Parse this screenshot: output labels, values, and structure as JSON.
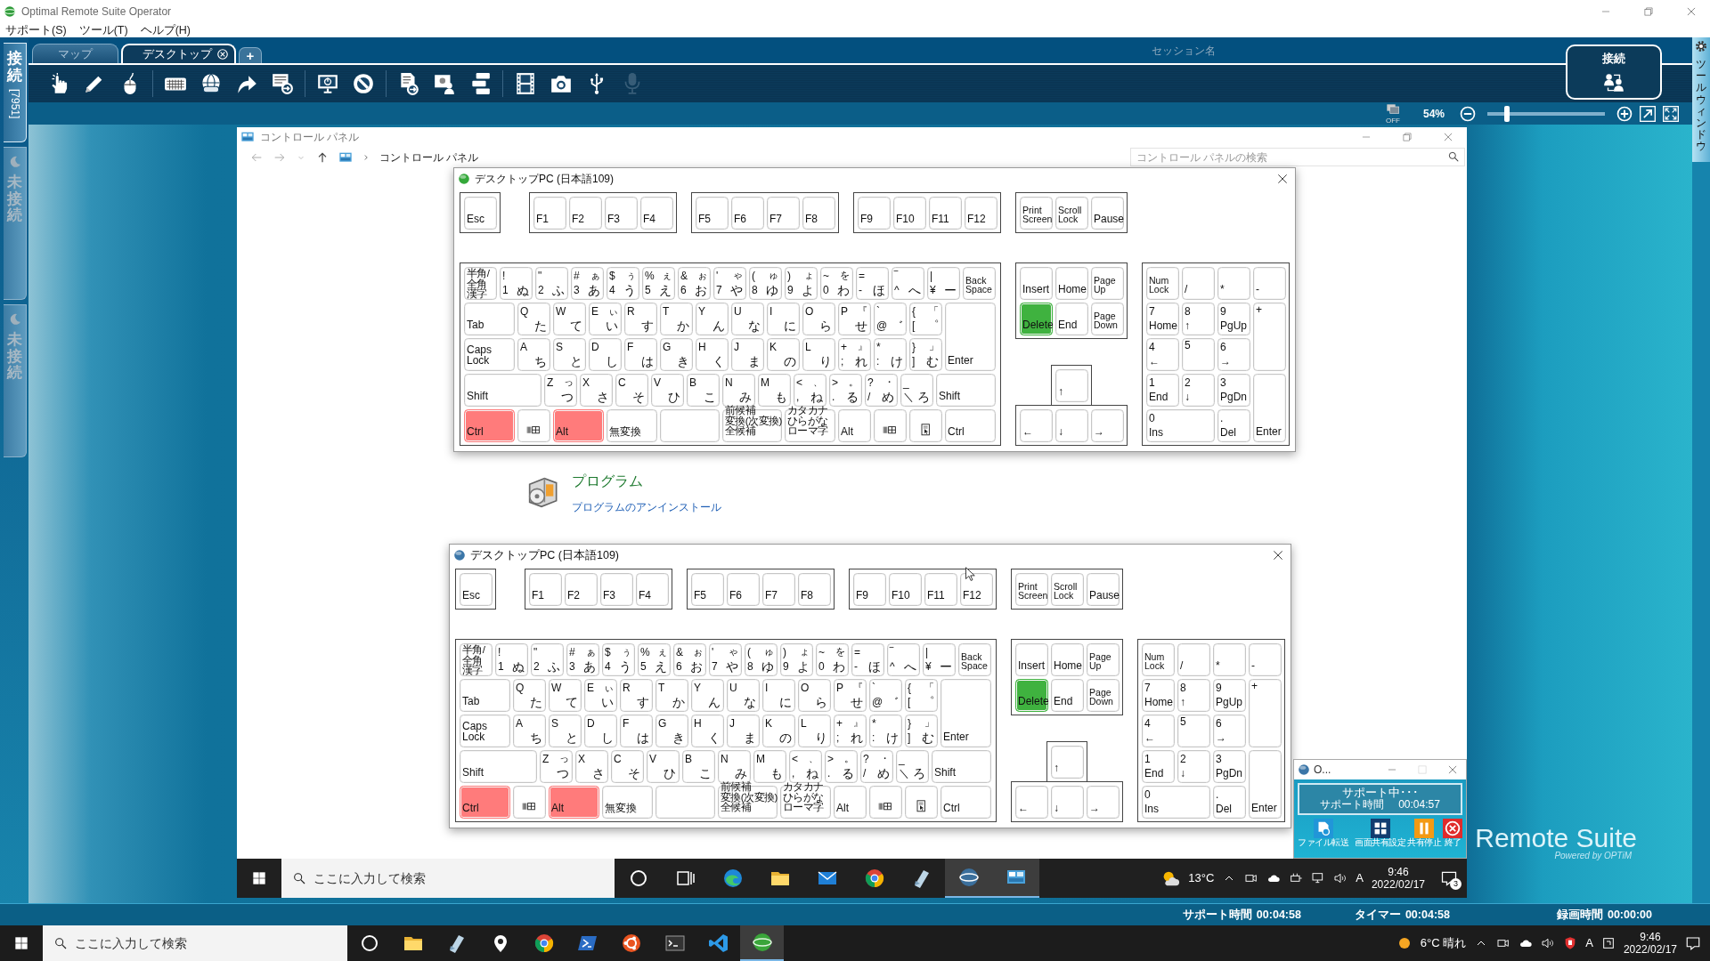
{
  "app": {
    "title": "Optimal Remote Suite Operator"
  },
  "menu": [
    "サポート(S)",
    "ツール(T)",
    "ヘルプ(H)"
  ],
  "side_tabs": [
    {
      "label": "接続",
      "detail": "[7951]",
      "selected": true
    },
    {
      "label": "未接続",
      "selected": false
    },
    {
      "label": "未接続",
      "selected": false
    }
  ],
  "tabs": [
    {
      "label": "マップ",
      "selected": false,
      "closable": false
    },
    {
      "label": "デスクトップ",
      "selected": true,
      "closable": true
    }
  ],
  "add_tab": "+",
  "toolbar": [
    [
      {
        "kind": "hand",
        "disabled": false
      },
      {
        "kind": "pencil",
        "disabled": false
      },
      {
        "kind": "mouse",
        "disabled": false
      }
    ],
    [
      {
        "kind": "keyboard",
        "disabled": false
      },
      {
        "kind": "globe",
        "disabled": false
      },
      {
        "kind": "arrow",
        "disabled": false
      },
      {
        "kind": "screendoc",
        "disabled": false
      }
    ],
    [
      {
        "kind": "monitor",
        "disabled": false
      },
      {
        "kind": "prohibit",
        "disabled": false
      }
    ],
    [
      {
        "kind": "docsend",
        "disabled": false
      },
      {
        "kind": "people",
        "disabled": false
      },
      {
        "kind": "keys",
        "disabled": false
      }
    ],
    [
      {
        "kind": "film",
        "disabled": false
      },
      {
        "kind": "camera",
        "disabled": false
      },
      {
        "kind": "usb",
        "disabled": false
      },
      {
        "kind": "mic",
        "disabled": true
      }
    ]
  ],
  "session_label": "セッション名",
  "connect_panel": {
    "label": "接続"
  },
  "zoom": {
    "monitor_label": "OFF",
    "percent": "54%",
    "level": 0.17
  },
  "tool_window_tab": "ツールウィンドウ",
  "remote": {
    "control_panel": {
      "title": "コントロール パネル",
      "breadcrumb": "コントロール パネル",
      "search_placeholder": "コントロール パネルの検索",
      "category": {
        "title": "プログラム",
        "link": "プログラムのアンインストール"
      }
    },
    "keyboards": [
      {
        "title": "デスクトップPC (日本語109)",
        "active": true,
        "fn": [
          [
            {
              "bl": "Esc",
              "pressed": false
            }
          ],
          [
            {
              "bl": "F1",
              "pressed": false
            },
            {
              "bl": "F2",
              "pressed": false
            },
            {
              "bl": "F3",
              "pressed": false
            },
            {
              "bl": "F4",
              "pressed": false
            }
          ],
          [
            {
              "bl": "F5",
              "pressed": false
            },
            {
              "bl": "F6",
              "pressed": false
            },
            {
              "bl": "F7",
              "pressed": false
            },
            {
              "bl": "F8",
              "pressed": false
            }
          ],
          [
            {
              "bl": "F9",
              "pressed": false
            },
            {
              "bl": "F10",
              "pressed": false
            },
            {
              "bl": "F11",
              "pressed": false
            },
            {
              "bl": "F12",
              "pressed": false
            }
          ],
          [
            {
              "bl": [
                "Print",
                "Screen"
              ],
              "pressed": false
            },
            {
              "bl": [
                "Scroll",
                "Lock"
              ],
              "pressed": false
            },
            {
              "bl": "Pause",
              "pressed": false
            }
          ]
        ],
        "main": [
          [
            {
              "tl": [
                "半角/",
                "全角",
                "漢字"
              ],
              "pressed": false
            },
            {
              "tl": "!",
              "bl": "1",
              "br": "ぬ",
              "pressed": false
            },
            {
              "tl": "\"",
              "bl": "2",
              "br": "ふ",
              "pressed": false
            },
            {
              "tl": "#",
              "tr": "ぁ",
              "bl": "3",
              "br": "あ",
              "pressed": false
            },
            {
              "tl": "$",
              "tr": "ぅ",
              "bl": "4",
              "br": "う",
              "pressed": false
            },
            {
              "tl": "%",
              "tr": "ぇ",
              "bl": "5",
              "br": "え",
              "pressed": false
            },
            {
              "tl": "&",
              "tr": "ぉ",
              "bl": "6",
              "br": "お",
              "pressed": false
            },
            {
              "tl": "'",
              "tr": "ゃ",
              "bl": "7",
              "br": "や",
              "pressed": false
            },
            {
              "tl": "(",
              "tr": "ゅ",
              "bl": "8",
              "br": "ゆ",
              "pressed": false
            },
            {
              "tl": ")",
              "tr": "ょ",
              "bl": "9",
              "br": "よ",
              "pressed": false
            },
            {
              "tl": "~",
              "tr": "を",
              "bl": "0",
              "br": "わ",
              "pressed": false
            },
            {
              "tl": "=",
              "bl": "-",
              "br": "ほ",
              "pressed": false
            },
            {
              "tl": "‾",
              "bl": "^",
              "br": "へ",
              "pressed": false
            },
            {
              "tl": "|",
              "bl": "¥",
              "br": "ー",
              "pressed": false
            },
            {
              "bl": [
                "Back",
                "Space"
              ],
              "pressed": false
            }
          ],
          [
            {
              "bl": "Tab",
              "pressed": false
            },
            {
              "tl": "Q",
              "br": "た",
              "pressed": false
            },
            {
              "tl": "W",
              "br": "て",
              "pressed": false
            },
            {
              "tl": "E",
              "tr": "ぃ",
              "br": "い",
              "pressed": false
            },
            {
              "tl": "R",
              "br": "す",
              "pressed": false
            },
            {
              "tl": "T",
              "br": "か",
              "pressed": false
            },
            {
              "tl": "Y",
              "br": "ん",
              "pressed": false
            },
            {
              "tl": "U",
              "br": "な",
              "pressed": false
            },
            {
              "tl": "I",
              "br": "に",
              "pressed": false
            },
            {
              "tl": "O",
              "br": "ら",
              "pressed": false
            },
            {
              "tl": "P",
              "tr": "『",
              "br": "せ",
              "pressed": false
            },
            {
              "tl": "`",
              "bl": "@",
              "br": "゛",
              "pressed": false
            },
            {
              "tl": "{",
              "tr": "「",
              "bl": "[",
              "br": "゜",
              "pressed": false
            },
            {
              "bl": "Enter",
              "pressed": false
            }
          ],
          [
            {
              "bl": "Caps Lock",
              "pressed": false
            },
            {
              "tl": "A",
              "br": "ち",
              "pressed": false
            },
            {
              "tl": "S",
              "br": "と",
              "pressed": false
            },
            {
              "tl": "D",
              "br": "し",
              "pressed": false
            },
            {
              "tl": "F",
              "br": "は",
              "pressed": false
            },
            {
              "tl": "G",
              "br": "き",
              "pressed": false
            },
            {
              "tl": "H",
              "br": "く",
              "pressed": false
            },
            {
              "tl": "J",
              "br": "ま",
              "pressed": false
            },
            {
              "tl": "K",
              "br": "の",
              "pressed": false
            },
            {
              "tl": "L",
              "br": "り",
              "pressed": false
            },
            {
              "tl": "+",
              "tr": "』",
              "bl": ";",
              "br": "れ",
              "pressed": false
            },
            {
              "tl": "*",
              "bl": ":",
              "br": "け",
              "pressed": false
            },
            {
              "tl": "}",
              "tr": "」",
              "bl": "]",
              "br": "む",
              "pressed": false
            }
          ],
          [
            {
              "bl": "Shift",
              "pressed": false
            },
            {
              "tl": "Z",
              "tr": "っ",
              "br": "つ",
              "pressed": false
            },
            {
              "tl": "X",
              "br": "さ",
              "pressed": false
            },
            {
              "tl": "C",
              "br": "そ",
              "pressed": false
            },
            {
              "tl": "V",
              "br": "ひ",
              "pressed": false
            },
            {
              "tl": "B",
              "br": "こ",
              "pressed": false
            },
            {
              "tl": "N",
              "br": "み",
              "pressed": false
            },
            {
              "tl": "M",
              "br": "も",
              "pressed": false
            },
            {
              "tl": "<",
              "tr": "、",
              "bl": ",",
              "br": "ね",
              "pressed": false
            },
            {
              "tl": ">",
              "tr": "。",
              "bl": ".",
              "br": "る",
              "pressed": false
            },
            {
              "tl": "?",
              "tr": "・",
              "bl": "/",
              "br": "め",
              "pressed": false
            },
            {
              "tl": "_",
              "bl": "＼",
              "br": "ろ",
              "pressed": false
            },
            {
              "bl": "Shift",
              "pressed": false
            }
          ],
          [
            {
              "bl": "Ctrl",
              "pressed": true,
              "color": "#ff7b7b"
            },
            {
              "kind": "win",
              "pressed": false
            },
            {
              "bl": "Alt",
              "pressed": true,
              "color": "#ff7b7b"
            },
            {
              "bl": "無変換",
              "pressed": false
            },
            {
              "pressed": false
            },
            {
              "bl": [
                "前候補",
                "変換(次変換)",
                "全候補"
              ],
              "pressed": false
            },
            {
              "bl": [
                "カタカナ",
                "ひらがな",
                "ローマ字"
              ],
              "pressed": false
            },
            {
              "bl": "Alt",
              "pressed": false
            },
            {
              "kind": "win",
              "pressed": false
            },
            {
              "kind": "menu",
              "pressed": false
            },
            {
              "bl": "Ctrl",
              "pressed": false
            }
          ]
        ],
        "edit": [
          [
            {
              "bl": "Insert",
              "pressed": false
            },
            {
              "bl": "Home",
              "pressed": false
            },
            {
              "bl": [
                "Page",
                "Up"
              ],
              "pressed": false
            }
          ],
          [
            {
              "bl": "Delete",
              "pressed": true,
              "color": "#3fb23f"
            },
            {
              "bl": "End",
              "pressed": false
            },
            {
              "bl": [
                "Page",
                "Down"
              ],
              "pressed": false
            }
          ]
        ],
        "arrows": [
          [
            {
              "bl": "↑",
              "pressed": false
            }
          ],
          [
            {
              "bl": "←",
              "pressed": false
            },
            {
              "bl": "↓",
              "pressed": false
            },
            {
              "bl": "→",
              "pressed": false
            }
          ]
        ],
        "numpad": [
          [
            {
              "bl": [
                "Num",
                "Lock"
              ],
              "pressed": false
            },
            {
              "bl": "/",
              "pressed": false
            },
            {
              "bl": "*",
              "pressed": false
            },
            {
              "bl": "-",
              "pressed": false
            }
          ],
          [
            {
              "tl": "7",
              "bl": "Home",
              "pressed": false
            },
            {
              "tl": "8",
              "bl": "↑",
              "pressed": false
            },
            {
              "tl": "9",
              "bl": "PgUp",
              "pressed": false
            },
            {
              "tl": "+",
              "pressed": false
            }
          ],
          [
            {
              "tl": "4",
              "bl": "←",
              "pressed": false
            },
            {
              "tl": "5",
              "pressed": false
            },
            {
              "tl": "6",
              "bl": "→",
              "pressed": false
            }
          ],
          [
            {
              "tl": "1",
              "bl": "End",
              "pressed": false
            },
            {
              "tl": "2",
              "bl": "↓",
              "pressed": false
            },
            {
              "tl": "3",
              "bl": "PgDn",
              "pressed": false
            },
            {
              "bl": "Enter",
              "pressed": false
            }
          ],
          [
            {
              "tl": "0",
              "bl": "Ins",
              "pressed": false
            },
            {
              "tl": ".",
              "bl": "Del",
              "pressed": false
            }
          ]
        ]
      },
      {
        "title": "デスクトップPC (日本語109)",
        "active": false,
        "fn": [
          [
            {
              "bl": "Esc",
              "pressed": false
            }
          ],
          [
            {
              "bl": "F1",
              "pressed": false
            },
            {
              "bl": "F2",
              "pressed": false
            },
            {
              "bl": "F3",
              "pressed": false
            },
            {
              "bl": "F4",
              "pressed": false
            }
          ],
          [
            {
              "bl": "F5",
              "pressed": false
            },
            {
              "bl": "F6",
              "pressed": false
            },
            {
              "bl": "F7",
              "pressed": false
            },
            {
              "bl": "F8",
              "pressed": false
            }
          ],
          [
            {
              "bl": "F9",
              "pressed": false
            },
            {
              "bl": "F10",
              "pressed": false
            },
            {
              "bl": "F11",
              "pressed": false
            },
            {
              "bl": "F12",
              "pressed": false
            }
          ],
          [
            {
              "bl": [
                "Print",
                "Screen"
              ],
              "pressed": false
            },
            {
              "bl": [
                "Scroll",
                "Lock"
              ],
              "pressed": false
            },
            {
              "bl": "Pause",
              "pressed": false
            }
          ]
        ],
        "main": [
          [
            {
              "tl": [
                "半角/",
                "全角",
                "漢字"
              ],
              "pressed": false
            },
            {
              "tl": "!",
              "bl": "1",
              "br": "ぬ",
              "pressed": false
            },
            {
              "tl": "\"",
              "bl": "2",
              "br": "ふ",
              "pressed": false
            },
            {
              "tl": "#",
              "tr": "ぁ",
              "bl": "3",
              "br": "あ",
              "pressed": false
            },
            {
              "tl": "$",
              "tr": "ぅ",
              "bl": "4",
              "br": "う",
              "pressed": false
            },
            {
              "tl": "%",
              "tr": "ぇ",
              "bl": "5",
              "br": "え",
              "pressed": false
            },
            {
              "tl": "&",
              "tr": "ぉ",
              "bl": "6",
              "br": "お",
              "pressed": false
            },
            {
              "tl": "'",
              "tr": "ゃ",
              "bl": "7",
              "br": "や",
              "pressed": false
            },
            {
              "tl": "(",
              "tr": "ゅ",
              "bl": "8",
              "br": "ゆ",
              "pressed": false
            },
            {
              "tl": ")",
              "tr": "ょ",
              "bl": "9",
              "br": "よ",
              "pressed": false
            },
            {
              "tl": "~",
              "tr": "を",
              "bl": "0",
              "br": "わ",
              "pressed": false
            },
            {
              "tl": "=",
              "bl": "-",
              "br": "ほ",
              "pressed": false
            },
            {
              "tl": "‾",
              "bl": "^",
              "br": "へ",
              "pressed": false
            },
            {
              "tl": "|",
              "bl": "¥",
              "br": "ー",
              "pressed": false
            },
            {
              "bl": [
                "Back",
                "Space"
              ],
              "pressed": false
            }
          ],
          [
            {
              "bl": "Tab",
              "pressed": false
            },
            {
              "tl": "Q",
              "br": "た",
              "pressed": false
            },
            {
              "tl": "W",
              "br": "て",
              "pressed": false
            },
            {
              "tl": "E",
              "tr": "ぃ",
              "br": "い",
              "pressed": false
            },
            {
              "tl": "R",
              "br": "す",
              "pressed": false
            },
            {
              "tl": "T",
              "br": "か",
              "pressed": false
            },
            {
              "tl": "Y",
              "br": "ん",
              "pressed": false
            },
            {
              "tl": "U",
              "br": "な",
              "pressed": false
            },
            {
              "tl": "I",
              "br": "に",
              "pressed": false
            },
            {
              "tl": "O",
              "br": "ら",
              "pressed": false
            },
            {
              "tl": "P",
              "tr": "『",
              "br": "せ",
              "pressed": false
            },
            {
              "tl": "`",
              "bl": "@",
              "br": "゛",
              "pressed": false
            },
            {
              "tl": "{",
              "tr": "「",
              "bl": "[",
              "br": "゜",
              "pressed": false
            },
            {
              "bl": "Enter",
              "pressed": false
            }
          ],
          [
            {
              "bl": "Caps Lock",
              "pressed": false
            },
            {
              "tl": "A",
              "br": "ち",
              "pressed": false
            },
            {
              "tl": "S",
              "br": "と",
              "pressed": false
            },
            {
              "tl": "D",
              "br": "し",
              "pressed": false
            },
            {
              "tl": "F",
              "br": "は",
              "pressed": false
            },
            {
              "tl": "G",
              "br": "き",
              "pressed": false
            },
            {
              "tl": "H",
              "br": "く",
              "pressed": false
            },
            {
              "tl": "J",
              "br": "ま",
              "pressed": false
            },
            {
              "tl": "K",
              "br": "の",
              "pressed": false
            },
            {
              "tl": "L",
              "br": "り",
              "pressed": false
            },
            {
              "tl": "+",
              "tr": "』",
              "bl": ";",
              "br": "れ",
              "pressed": false
            },
            {
              "tl": "*",
              "bl": ":",
              "br": "け",
              "pressed": false
            },
            {
              "tl": "}",
              "tr": "」",
              "bl": "]",
              "br": "む",
              "pressed": false
            }
          ],
          [
            {
              "bl": "Shift",
              "pressed": false
            },
            {
              "tl": "Z",
              "tr": "っ",
              "br": "つ",
              "pressed": false
            },
            {
              "tl": "X",
              "br": "さ",
              "pressed": false
            },
            {
              "tl": "C",
              "br": "そ",
              "pressed": false
            },
            {
              "tl": "V",
              "br": "ひ",
              "pressed": false
            },
            {
              "tl": "B",
              "br": "こ",
              "pressed": false
            },
            {
              "tl": "N",
              "br": "み",
              "pressed": false
            },
            {
              "tl": "M",
              "br": "も",
              "pressed": false
            },
            {
              "tl": "<",
              "tr": "、",
              "bl": ",",
              "br": "ね",
              "pressed": false
            },
            {
              "tl": ">",
              "tr": "。",
              "bl": ".",
              "br": "る",
              "pressed": false
            },
            {
              "tl": "?",
              "tr": "・",
              "bl": "/",
              "br": "め",
              "pressed": false
            },
            {
              "tl": "_",
              "bl": "＼",
              "br": "ろ",
              "pressed": false
            },
            {
              "bl": "Shift",
              "pressed": false
            }
          ],
          [
            {
              "bl": "Ctrl",
              "pressed": true,
              "color": "#ff7b7b"
            },
            {
              "kind": "win",
              "pressed": false
            },
            {
              "bl": "Alt",
              "pressed": true,
              "color": "#ff7b7b"
            },
            {
              "bl": "無変換",
              "pressed": false
            },
            {
              "pressed": false
            },
            {
              "bl": [
                "前候補",
                "変換(次変換)",
                "全候補"
              ],
              "pressed": false
            },
            {
              "bl": [
                "カタカナ",
                "ひらがな",
                "ローマ字"
              ],
              "pressed": false
            },
            {
              "bl": "Alt",
              "pressed": false
            },
            {
              "kind": "win",
              "pressed": false
            },
            {
              "kind": "menu",
              "pressed": false
            },
            {
              "bl": "Ctrl",
              "pressed": false
            }
          ]
        ],
        "edit": [
          [
            {
              "bl": "Insert",
              "pressed": false
            },
            {
              "bl": "Home",
              "pressed": false
            },
            {
              "bl": [
                "Page",
                "Up"
              ],
              "pressed": false
            }
          ],
          [
            {
              "bl": "Delete",
              "pressed": true,
              "color": "#3fb23f"
            },
            {
              "bl": "End",
              "pressed": false
            },
            {
              "bl": [
                "Page",
                "Down"
              ],
              "pressed": false
            }
          ]
        ],
        "arrows": [
          [
            {
              "bl": "↑",
              "pressed": false
            }
          ],
          [
            {
              "bl": "←",
              "pressed": false
            },
            {
              "bl": "↓",
              "pressed": false
            },
            {
              "bl": "→",
              "pressed": false
            }
          ]
        ],
        "numpad": [
          [
            {
              "bl": [
                "Num",
                "Lock"
              ],
              "pressed": false
            },
            {
              "bl": "/",
              "pressed": false
            },
            {
              "bl": "*",
              "pressed": false
            },
            {
              "bl": "-",
              "pressed": false
            }
          ],
          [
            {
              "tl": "7",
              "bl": "Home",
              "pressed": false
            },
            {
              "tl": "8",
              "bl": "↑",
              "pressed": false
            },
            {
              "tl": "9",
              "bl": "PgUp",
              "pressed": false
            },
            {
              "tl": "+",
              "pressed": false
            }
          ],
          [
            {
              "tl": "4",
              "bl": "←",
              "pressed": false
            },
            {
              "tl": "5",
              "pressed": false
            },
            {
              "tl": "6",
              "bl": "→",
              "pressed": false
            }
          ],
          [
            {
              "tl": "1",
              "bl": "End",
              "pressed": false
            },
            {
              "tl": "2",
              "bl": "↓",
              "pressed": false
            },
            {
              "tl": "3",
              "bl": "PgDn",
              "pressed": false
            },
            {
              "bl": "Enter",
              "pressed": false
            }
          ],
          [
            {
              "tl": "0",
              "bl": "Ins",
              "pressed": false
            },
            {
              "tl": ".",
              "bl": "Del",
              "pressed": false
            }
          ]
        ]
      }
    ],
    "support_window": {
      "title": "O...",
      "status": "サポート中･･･",
      "time_label": "サポート時間",
      "time": "00:04:57",
      "actions": [
        {
          "kind": "file",
          "label": "ファイル転送"
        },
        {
          "kind": "screen",
          "label": "画面共有設定"
        },
        {
          "kind": "pause",
          "label": "共有停止"
        },
        {
          "kind": "end",
          "label": "終了"
        }
      ]
    },
    "taskbar": {
      "search_placeholder": "ここに入力して検索",
      "apps": [
        {
          "kind": "circle",
          "active": false
        },
        {
          "kind": "taskview",
          "active": false
        },
        {
          "kind": "edge",
          "active": false
        },
        {
          "kind": "folder",
          "active": false
        },
        {
          "kind": "mail",
          "active": false
        },
        {
          "kind": "chrome",
          "active": false
        },
        {
          "kind": "notepad",
          "active": false
        },
        {
          "kind": "orb",
          "active": true
        },
        {
          "kind": "controlpanel",
          "active": true
        }
      ],
      "weather": "13°C",
      "ime": "A",
      "time": "9:46",
      "date": "2022/02/17",
      "notifications": "3"
    }
  },
  "brand": {
    "name": "Remote Suite",
    "tagline": "Powered by OPTiM"
  },
  "status_bar": [
    {
      "label": "サポート時間",
      "value": "00:04:58"
    },
    {
      "label": "タイマー",
      "value": "00:04:58"
    },
    {
      "label": "録画時間",
      "value": "00:00:00"
    }
  ],
  "taskbar": {
    "search_placeholder": "ここに入力して検索",
    "apps": [
      {
        "kind": "circle",
        "active": false
      },
      {
        "kind": "folder",
        "active": false
      },
      {
        "kind": "notepad",
        "active": false
      },
      {
        "kind": "pin",
        "active": false
      },
      {
        "kind": "chrome",
        "active": false
      },
      {
        "kind": "powershell",
        "active": false
      },
      {
        "kind": "ubuntu",
        "active": false
      },
      {
        "kind": "terminal",
        "active": false
      },
      {
        "kind": "vscode",
        "active": false
      },
      {
        "kind": "orbgreen",
        "active": true
      }
    ],
    "weather": "6°C 晴れ",
    "ime": "A",
    "time": "9:46",
    "date": "2022/02/17"
  }
}
